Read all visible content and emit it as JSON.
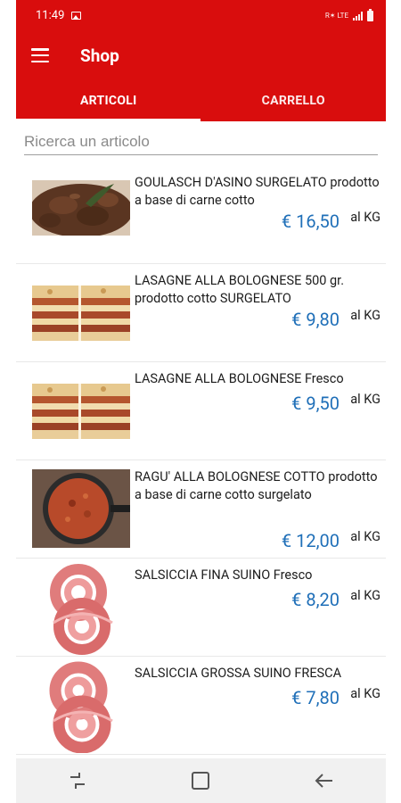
{
  "status": {
    "time": "11:49",
    "indicators": "R✶ LTE"
  },
  "appbar": {
    "title": "Shop",
    "menu_icon": "hamburger-menu-icon"
  },
  "tabs": [
    {
      "label": "ARTICOLI",
      "selected": true
    },
    {
      "label": "CARRELLO",
      "selected": false
    }
  ],
  "search": {
    "placeholder": "Ricerca un articolo",
    "value": ""
  },
  "items": [
    {
      "name": "GOULASCH D'ASINO SURGELATO prodotto a base di carne cotto",
      "price": "€ 16,50",
      "unit": "al KG",
      "image": "goulash-image"
    },
    {
      "name": "LASAGNE ALLA BOLOGNESE 500 gr. prodotto cotto SURGELATO",
      "price": "€ 9,80",
      "unit": "al KG",
      "image": "lasagne-image"
    },
    {
      "name": "LASAGNE ALLA BOLOGNESE Fresco",
      "price": "€ 9,50",
      "unit": "al KG",
      "image": "lasagne-image"
    },
    {
      "name": "RAGU' ALLA BOLOGNESE COTTO prodotto a base di carne cotto surgelato",
      "price": "€ 12,00",
      "unit": "al KG",
      "image": "ragu-image"
    },
    {
      "name": "SALSICCIA FINA SUINO Fresco",
      "price": "€ 8,20",
      "unit": "al KG",
      "image": "sausage-image"
    },
    {
      "name": "SALSICCIA GROSSA SUINO FRESCA",
      "price": "€ 7,80",
      "unit": "al KG",
      "image": "sausage-image"
    }
  ],
  "navbar": {
    "icons": [
      "recent-apps-icon",
      "home-icon",
      "back-icon"
    ]
  },
  "colors": {
    "primary": "#d90d0d",
    "price": "#1f6fb8"
  }
}
